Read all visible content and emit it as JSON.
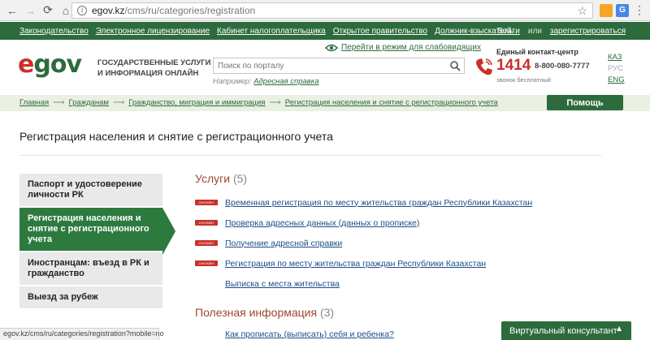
{
  "browser": {
    "url_host": "egov.kz",
    "url_path": "/cms/ru/categories/registration",
    "status_url": "egov.kz/cms/ru/categories/registration?mobile=no"
  },
  "topbar": {
    "links": [
      "Законодательство",
      "Электронное лицензирование",
      "Кабинет налогоплательщика",
      "Открытое правительство",
      "Должник-взыскатель"
    ],
    "login": "Войти",
    "or": "или",
    "register": "зарегистрироваться"
  },
  "header": {
    "logo_e": "e",
    "logo_gov": "gov",
    "tagline": "ГОСУДАРСТВЕННЫЕ УСЛУГИ И ИНФОРМАЦИЯ ОНЛАЙН",
    "low_vision": "Перейти в режим для слабовидящих",
    "search_placeholder": "Поиск по порталу",
    "hint_prefix": "Например:",
    "hint_link": "Адресная справка",
    "contact_label": "Единый контакт-центр",
    "contact_short": "1414",
    "contact_number": "8-800-080-7777",
    "contact_free": "звонок бесплатный",
    "langs": [
      "КАЗ",
      "РУС",
      "ENG"
    ]
  },
  "breadcrumb": [
    "Главная",
    "Гражданам",
    "Гражданство, миграция и иммиграция",
    "Регистрация населения и снятие с регистрационного учета"
  ],
  "help_button": "Помощь",
  "page_title": "Регистрация населения и снятие с регистрационного учета",
  "sidebar": [
    {
      "label": "Паспорт и удостоверение личности РК"
    },
    {
      "label": "Регистрация населения и снятие с регистрационного учета"
    },
    {
      "label": "Иностранцам: въезд в РК и гражданство"
    },
    {
      "label": "Выезд за рубеж"
    }
  ],
  "services": {
    "title": "Услуги",
    "count": "(5)",
    "badge_text": "ОНЛАЙН",
    "items": [
      {
        "label": "Временная регистрация по месту жительства граждан Республики Казахстан",
        "online": true
      },
      {
        "label": "Проверка адресных данных (данных о прописке)",
        "online": true
      },
      {
        "label": "Получение адресной справки",
        "online": true
      },
      {
        "label": "Регистрация по месту жительства граждан Республики Казахстан",
        "online": true
      },
      {
        "label": "Выписка с места жительства",
        "online": false
      }
    ]
  },
  "useful": {
    "title": "Полезная информация",
    "count": "(3)",
    "first_link": "Как прописать (выписать) себя и ребенка?"
  },
  "consultant": {
    "label": "Виртуальный консультант"
  },
  "colors": {
    "brand_green": "#2d6b3d",
    "accent_red": "#c9302c",
    "link_blue": "#1c4f86",
    "section_title": "#a0452a"
  }
}
